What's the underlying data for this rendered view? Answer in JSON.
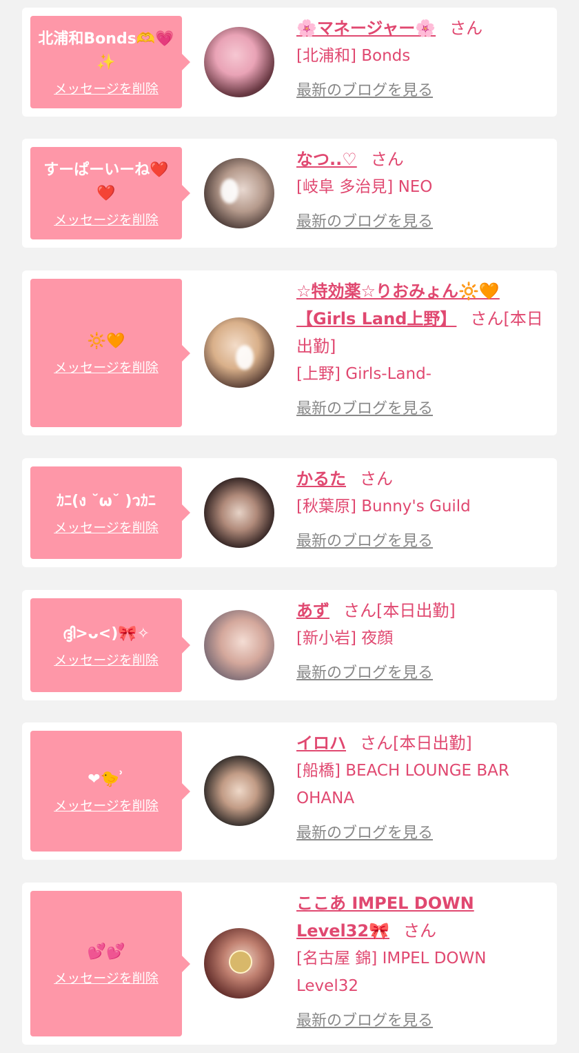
{
  "common": {
    "delete_label": "メッセージを削除",
    "blog_label": "最新のブログを見る",
    "san": "さん",
    "accent_color": "#e04870",
    "bubble_color": "#fe97a8"
  },
  "messages": [
    {
      "message": "北浦和Bonds🫶💗✨",
      "name": "🌸マネージャー🌸",
      "status": "",
      "shop": "[北浦和] Bonds"
    },
    {
      "message": "すーぱーいーね❤️❤️",
      "name": "なつ..♡",
      "status": "",
      "shop": "[岐阜 多治見] NEO"
    },
    {
      "message": "🔆🧡",
      "name": "☆特効薬☆りおみょん🔆🧡【Girls Land上野】",
      "status": "[本日出勤]",
      "shop": "[上野] Girls-Land-"
    },
    {
      "message": "ｶﾆ(ง ˘ω˘ )วｶﾆ",
      "name": "かるた",
      "status": "",
      "shop": "[秋葉原] Bunny's Guild"
    },
    {
      "message": "ദ്ദി>ᴗ<)🎀✧",
      "name": "あず",
      "status": "[本日出勤]",
      "shop": "[新小岩] 夜顔"
    },
    {
      "message": "❤︎🐤 ͗",
      "name": "イロハ",
      "status": "[本日出勤]",
      "shop": "[船橋] BEACH LOUNGE BAR OHANA"
    },
    {
      "message": "💕💕",
      "name": "ここあ IMPEL DOWN Level32🎀",
      "status": "",
      "shop": "[名古屋 錦] IMPEL DOWN Level32"
    }
  ]
}
